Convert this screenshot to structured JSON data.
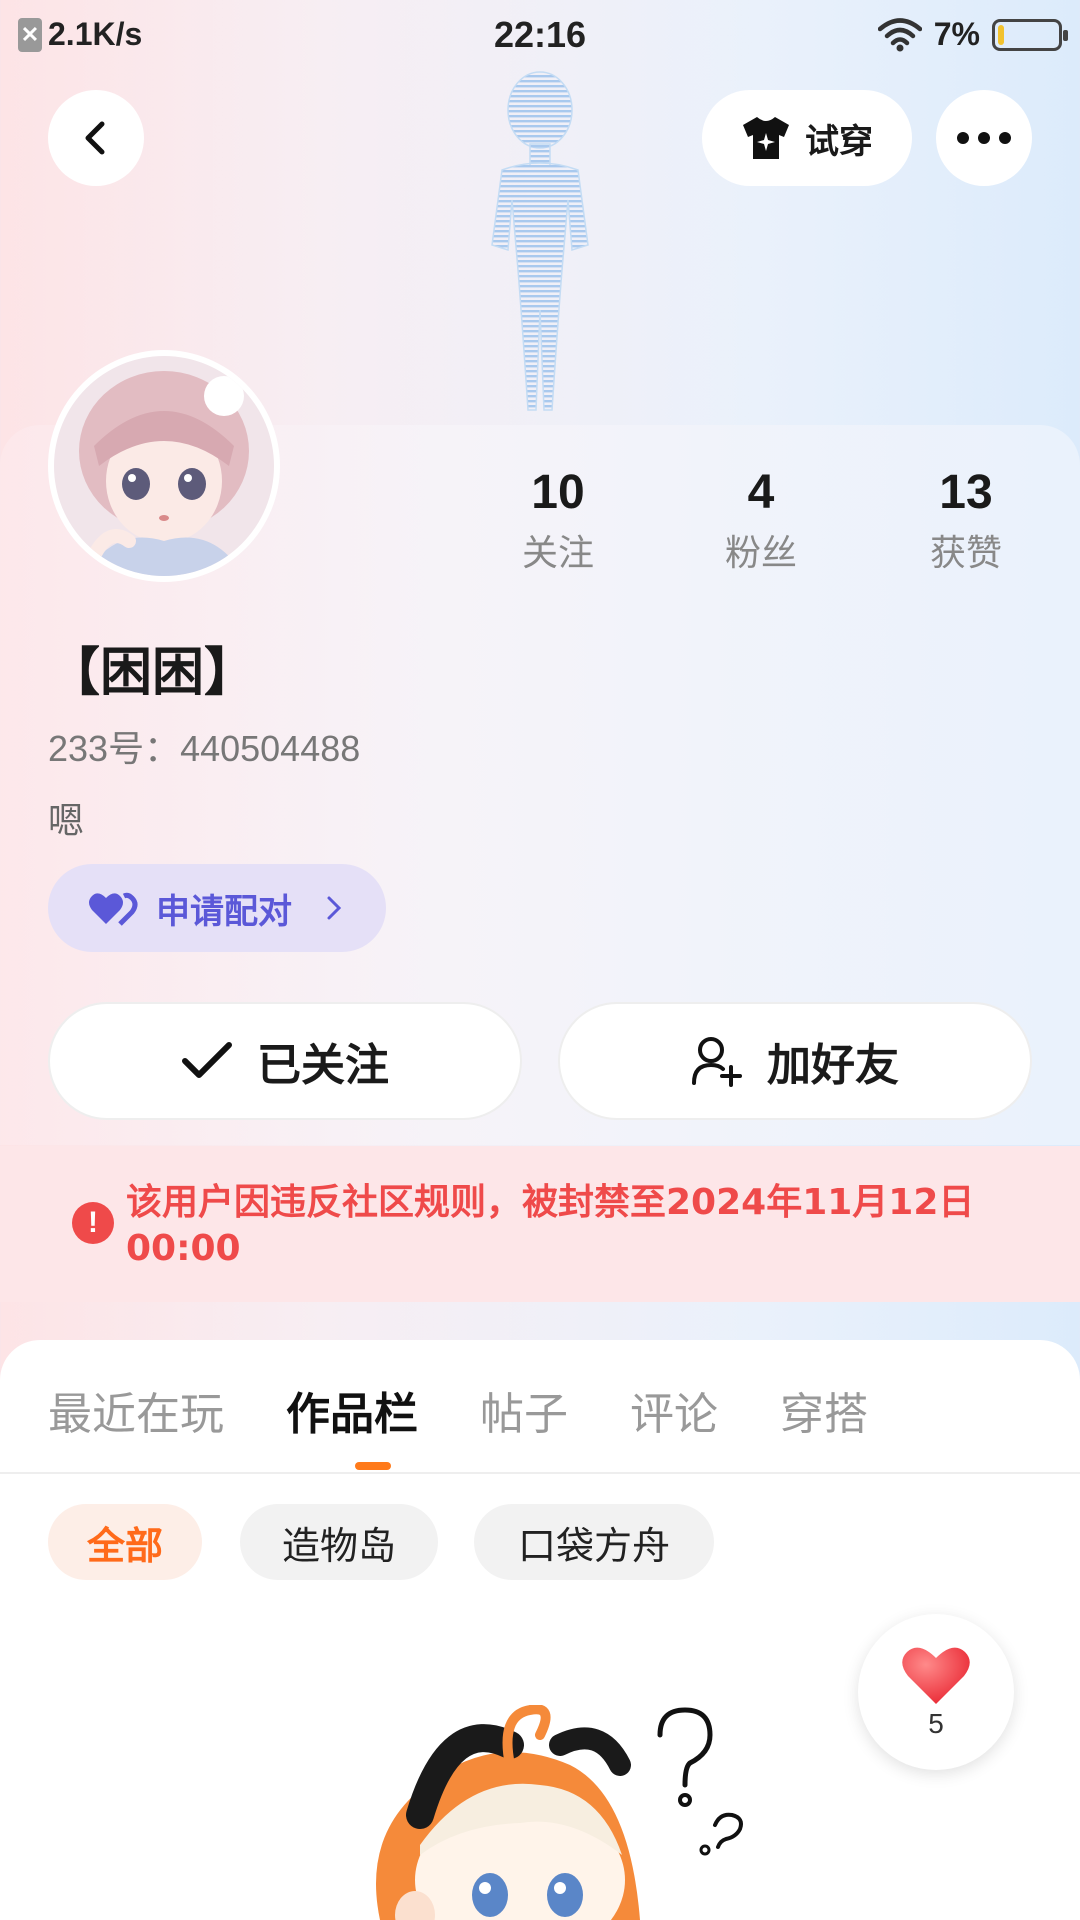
{
  "status_bar": {
    "net_speed": "2.1K/s",
    "time": "22:16",
    "battery": "7%",
    "battery_level": 0.07
  },
  "header": {
    "tryon_label": "试穿"
  },
  "profile": {
    "stats": [
      {
        "value": "10",
        "label": "关注"
      },
      {
        "value": "4",
        "label": "粉丝"
      },
      {
        "value": "13",
        "label": "获赞"
      }
    ],
    "nickname": "【困困】",
    "uid": "233号：440504488",
    "bio": "嗯",
    "pair_label": "申请配对",
    "followed_label": "已关注",
    "add_friend_label": "加好友"
  },
  "ban_notice": "该用户因违反社区规则，被封禁至2024年11月12日00:00",
  "tabs": [
    {
      "label": "最近在玩",
      "active": false
    },
    {
      "label": "作品栏",
      "active": true
    },
    {
      "label": "帖子",
      "active": false
    },
    {
      "label": "评论",
      "active": false
    },
    {
      "label": "穿搭",
      "active": false
    }
  ],
  "filters": [
    {
      "label": "全部",
      "active": true
    },
    {
      "label": "造物岛",
      "active": false
    },
    {
      "label": "口袋方舟",
      "active": false
    }
  ],
  "like_float": {
    "count": "5"
  },
  "colors": {
    "accent": "#ff7a1a",
    "ban_red": "#ef4a4a",
    "pair_purple": "#5b58d8"
  }
}
